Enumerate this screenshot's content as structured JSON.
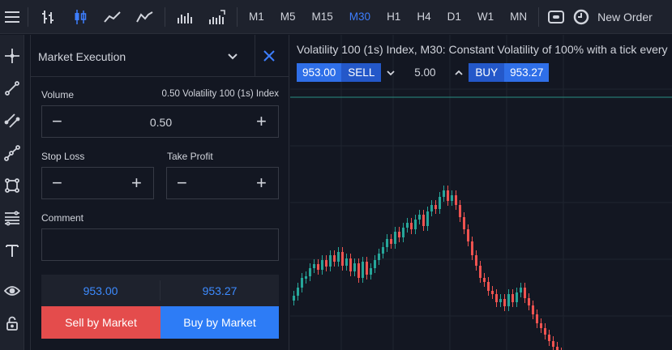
{
  "toolbar": {
    "timeframes": [
      "M1",
      "M5",
      "M15",
      "M30",
      "H1",
      "H4",
      "D1",
      "W1",
      "MN"
    ],
    "active_timeframe": "M30",
    "new_order_label": "New Order",
    "accent_color": "#3d7eff"
  },
  "left_tools": [
    "crosshair-icon",
    "trend-line-icon",
    "parallel-channel-icon",
    "path-icon",
    "shape-icon",
    "fibonacci-icon",
    "text-icon",
    "visibility-icon",
    "lock-icon"
  ],
  "order_panel": {
    "title": "Market Execution",
    "volume_label": "Volume",
    "volume_hint": "0.50 Volatility 100 (1s) Index",
    "volume_value": "0.50",
    "stop_loss_label": "Stop Loss",
    "take_profit_label": "Take Profit",
    "comment_label": "Comment",
    "comment_value": "",
    "bid_price": "953.00",
    "ask_price": "953.27",
    "sell_label": "Sell by Market",
    "buy_label": "Buy by Market",
    "sell_color": "#e44c4c",
    "buy_color": "#2d7cf6"
  },
  "chart": {
    "title": "Volatility 100 (1s) Index, M30: Constant Volatility of 100% with a tick every",
    "sell_price": "953.00",
    "sell_label": "SELL",
    "volume": "5.00",
    "buy_label": "BUY",
    "buy_price": "953.27",
    "up_color": "#26a69a",
    "down_color": "#ef5350"
  }
}
